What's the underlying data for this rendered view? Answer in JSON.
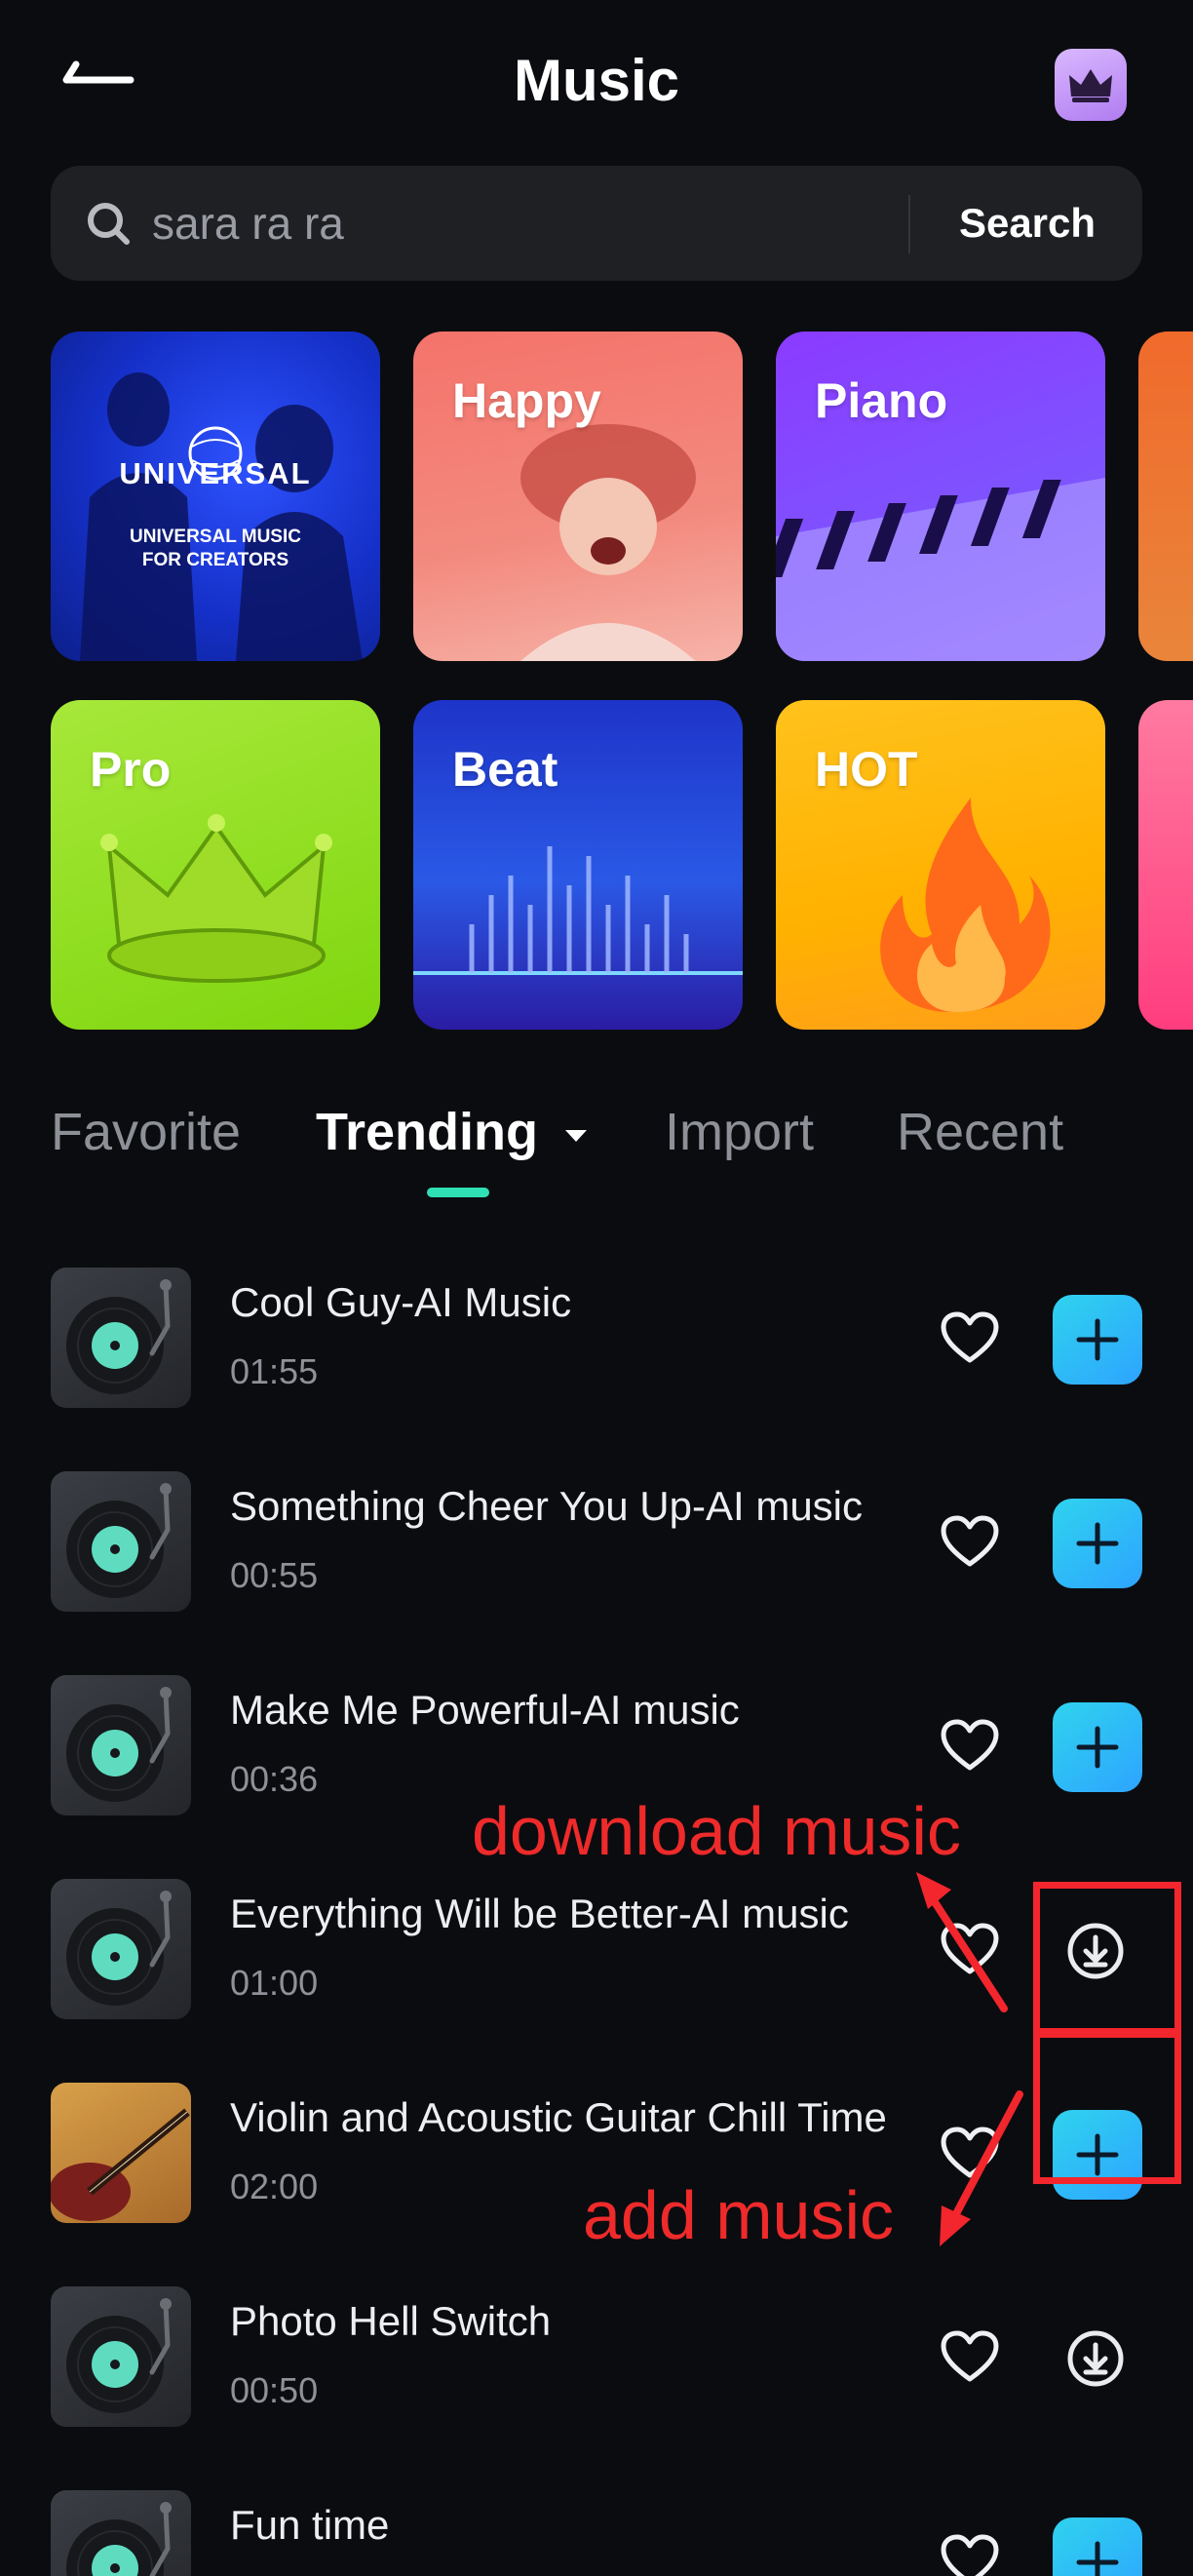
{
  "header": {
    "title": "Music"
  },
  "search": {
    "placeholder": "sara ra ra",
    "button_label": "Search"
  },
  "categories": [
    {
      "id": "universal",
      "label": "",
      "line1": "UNIVERSAL",
      "line2": "UNIVERSAL MUSIC",
      "line3": "FOR CREATORS"
    },
    {
      "id": "happy",
      "label": "Happy"
    },
    {
      "id": "piano",
      "label": "Piano"
    },
    {
      "id": "pro",
      "label": "Pro"
    },
    {
      "id": "beat",
      "label": "Beat"
    },
    {
      "id": "hot",
      "label": "HOT"
    }
  ],
  "tabs": [
    {
      "label": "Favorite",
      "active": false
    },
    {
      "label": "Trending",
      "active": true
    },
    {
      "label": "Import",
      "active": false
    },
    {
      "label": "Recent",
      "active": false
    }
  ],
  "tracks": [
    {
      "name": "Cool Guy-AI Music",
      "duration": "01:55",
      "action": "add",
      "thumb": "vinyl"
    },
    {
      "name": "Something Cheer You Up-AI music",
      "duration": "00:55",
      "action": "add",
      "thumb": "vinyl"
    },
    {
      "name": "Make Me Powerful-AI music",
      "duration": "00:36",
      "action": "add",
      "thumb": "vinyl"
    },
    {
      "name": "Everything Will be Better-AI music",
      "duration": "01:00",
      "action": "download",
      "thumb": "vinyl"
    },
    {
      "name": "Violin and Acoustic Guitar Chill Time",
      "duration": "02:00",
      "action": "add",
      "thumb": "guitar"
    },
    {
      "name": "Photo Hell Switch",
      "duration": "00:50",
      "action": "download",
      "thumb": "vinyl"
    },
    {
      "name": "Fun time",
      "duration": "",
      "action": "add",
      "thumb": "vinyl"
    }
  ],
  "annotations": {
    "download_label": "download music",
    "add_label": "add music",
    "color": "#ee2a2a"
  },
  "colors": {
    "accent": "#2fe0b5",
    "add_button": "#2ea4ff",
    "background": "#0b0c10"
  }
}
